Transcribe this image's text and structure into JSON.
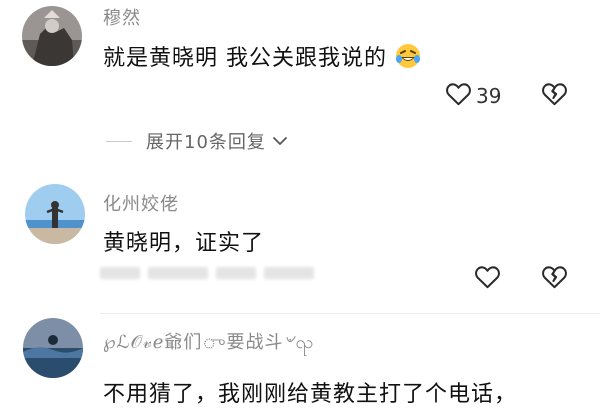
{
  "comments": [
    {
      "username": "穆然",
      "text": "就是黄晓明 我公关跟我说的",
      "likes": "39",
      "emoji": "rolling-on-floor-laughing"
    },
    {
      "username": "化州姣佬",
      "text": "黄晓明，证实了"
    },
    {
      "username": "℘ℒ𝒪𝓋ℯ爺们ு要战斗৺ၺ",
      "text": "不用猜了，我刚刚给黄教主打了个电话，"
    }
  ],
  "replies": {
    "expand_label": "展开10条回复"
  },
  "icons": {
    "like": "heart-outline-icon",
    "dislike": "broken-heart-icon",
    "chevron": "chevron-down-icon"
  }
}
